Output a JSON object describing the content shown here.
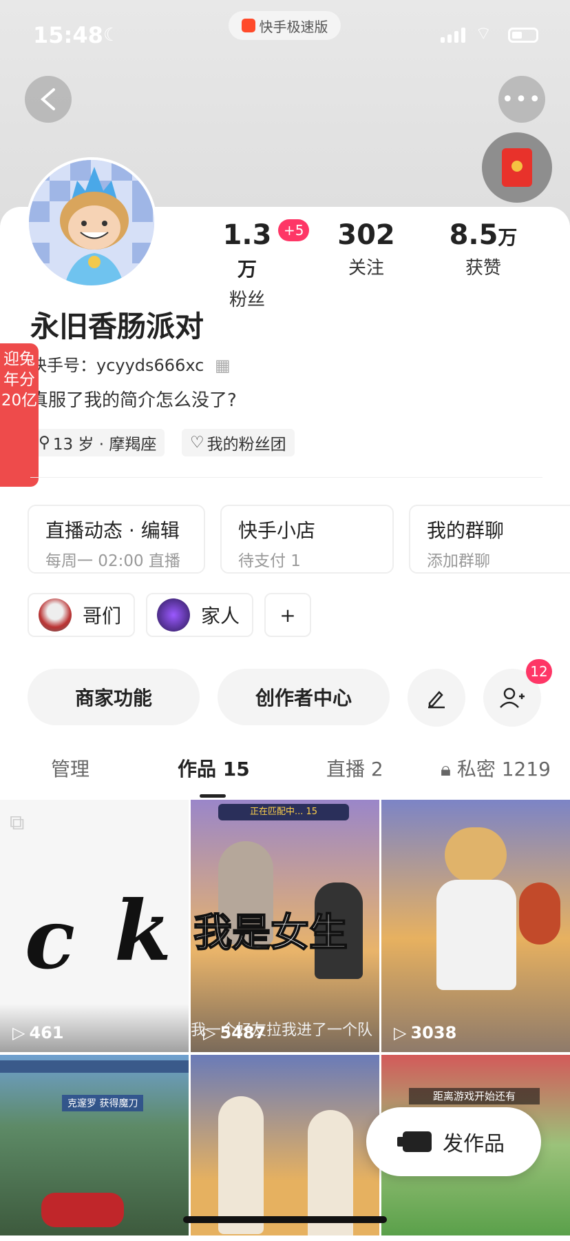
{
  "status": {
    "time": "15:48",
    "app_pill": "快手极速版"
  },
  "profile": {
    "name": "永旧香肠派对",
    "kuaishou_id": "快手号：ycyyds666xc",
    "bio": "真服了我的简介怎么没了?",
    "tags": [
      "13 岁 · 摩羯座",
      "我的粉丝团"
    ],
    "stats": [
      {
        "value": "1.3",
        "unit": "万",
        "label": "粉丝"
      },
      {
        "value": "302",
        "unit": "",
        "label": "关注"
      },
      {
        "value": "8.5",
        "unit": "万",
        "label": "获赞"
      }
    ],
    "fans_delta": "+5"
  },
  "left_banner": "迎兔年分20亿",
  "func_cards": [
    {
      "title": "直播动态 · 编辑",
      "sub": "每周一 02:00 直播"
    },
    {
      "title": "快手小店",
      "sub": "待支付 1"
    },
    {
      "title": "我的群聊",
      "sub": "添加群聊"
    }
  ],
  "groups": [
    "哥们",
    "家人",
    "+"
  ],
  "actions": {
    "merchant": "商家功能",
    "creator": "创作者中心",
    "friend_count": "12"
  },
  "tabs": [
    "管理",
    "作品 15",
    "直播 2",
    "私密 1219"
  ],
  "videos": [
    {
      "plays": "461"
    },
    {
      "plays": "5487",
      "caption": "我是女生",
      "subtitle": "我一个好友拉我进了一个队",
      "banner": "正在匹配中... 15"
    },
    {
      "plays": "3038"
    },
    {
      "caption": "克邃罗 获得魔刀"
    },
    {},
    {
      "caption": "距离游戏开始还有"
    }
  ],
  "publish_label": "发作品",
  "colors": {
    "accent": "#fe3666",
    "banner": "#ee4b4b"
  }
}
